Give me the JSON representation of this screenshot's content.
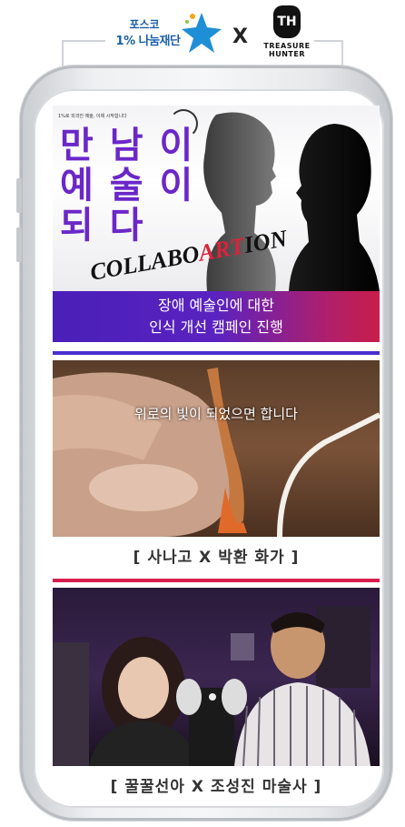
{
  "header": {
    "posco_line1": "포스코",
    "posco_line2": "1% 나눔재단",
    "x_mark": "X",
    "th_initials": "TH",
    "th_line1": "TREASURE",
    "th_line2": "HUNTER"
  },
  "poster": {
    "small_text": "1%로 외곽진 예술, 이제 시작합니다",
    "title_line1": "만 남 이",
    "title_line2": "예 술 이",
    "title_line3": "되    다",
    "collab_a": "COLLABO",
    "collab_b": "ART",
    "collab_c": "ION"
  },
  "banner": {
    "line1": "장애 예술인에 대한",
    "line2": "인식 개선 캠페인 진행"
  },
  "video1": {
    "subtitle": "위로의 빛이 되었으면 합니다",
    "caption": "[ 사나고  X  박환 화가 ]"
  },
  "video2": {
    "caption": "[ 꿀꿀선아  X  조성진 마술사 ]"
  },
  "colors": {
    "purple": "#5a22c0",
    "red": "#d8243a",
    "divider1": "#4a2fd0",
    "divider2": "#d81f4e"
  }
}
